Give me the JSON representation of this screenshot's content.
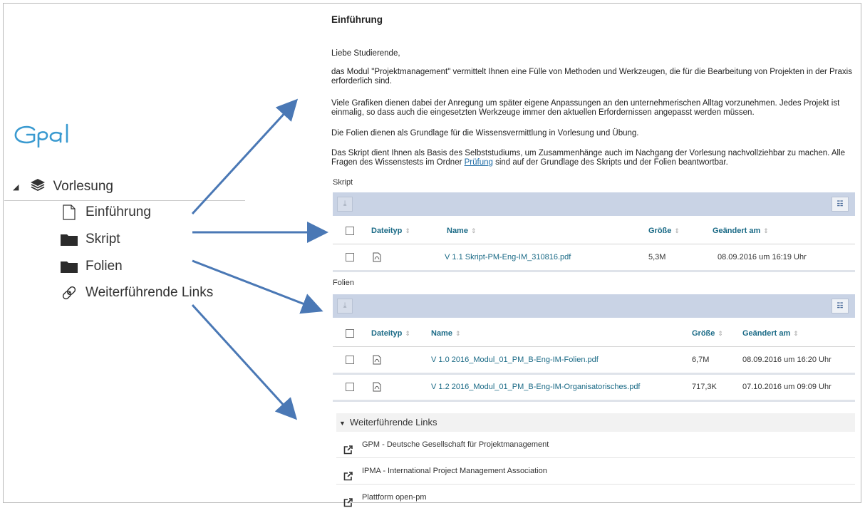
{
  "nav": {
    "root_label": "Vorlesung",
    "items": [
      {
        "label": "Einführung",
        "icon": "page-icon"
      },
      {
        "label": "Skript",
        "icon": "folder-icon"
      },
      {
        "label": "Folien",
        "icon": "folder-icon"
      },
      {
        "label": "Weiterführende Links",
        "icon": "chain-link-icon"
      }
    ]
  },
  "logo": {
    "text": "opal"
  },
  "content": {
    "title": "Einführung",
    "greeting": "Liebe Studierende,",
    "p1": "das Modul \"Projektmanagement\" vermittelt Ihnen eine Fülle von Methoden und Werkzeugen, die für die Bearbeitung von Projekten in der Praxis erforderlich sind.",
    "p2": "Viele Grafiken dienen dabei der Anregung um später eigene Anpassungen an den unternehmerischen Alltag vorzunehmen. Jedes Projekt ist einmalig, so dass auch die eingesetzten Werkzeuge immer den aktuellen Erfordernissen angepasst werden müssen.",
    "p3": "Die Folien dienen als Grundlage für die Wissensvermittlung in Vorlesung und Übung.",
    "p4_before": "Das Skript dient Ihnen als Basis des Selbststudiums, um Zusammenhänge auch im Nachgang der Vorlesung nachvollziehbar zu machen. Alle Fragen des Wissenstests im Ordner ",
    "p4_link": "Prüfung",
    "p4_after": " sind auf der Grundlage des Skripts und der Folien beantwortbar."
  },
  "columns": {
    "type": "Dateityp",
    "name": "Name",
    "size": "Größe",
    "changed": "Geändert am"
  },
  "skript": {
    "label": "Skript",
    "files": [
      {
        "name": "V 1.1 Skript-PM-Eng-IM_310816.pdf",
        "size": "5,3M",
        "changed": "08.09.2016 um 16:19 Uhr"
      }
    ]
  },
  "folien": {
    "label": "Folien",
    "files": [
      {
        "name": "V 1.0 2016_Modul_01_PM_B-Eng-IM-Folien.pdf",
        "size": "6,7M",
        "changed": "08.09.2016 um 16:20 Uhr"
      },
      {
        "name": "V 1.2 2016_Modul_01_PM_B-Eng-IM-Organisatorisches.pdf",
        "size": "717,3K",
        "changed": "07.10.2016 um 09:09 Uhr"
      }
    ]
  },
  "links": {
    "header": "Weiterführende Links",
    "items": [
      {
        "label": "GPM - Deutsche Gesellschaft für Projektmanagement"
      },
      {
        "label": "IPMA - International Project Management Association"
      },
      {
        "label": "Plattform open-pm"
      }
    ]
  },
  "colors": {
    "accent": "#1a6a86",
    "toolbar": "#c9d3e5",
    "arrow": "#4a78b5",
    "logo": "#3a9ad0"
  }
}
